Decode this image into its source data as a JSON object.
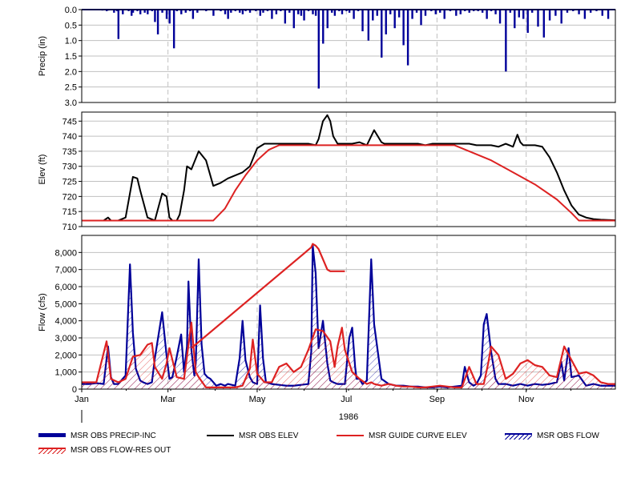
{
  "chart_data": [
    {
      "type": "bar",
      "ylabel": "Precip (in)",
      "ylim": [
        0,
        3
      ],
      "y_inverted": true,
      "yticks": [
        "0.0",
        "0.5",
        "1.0",
        "1.5",
        "2.0",
        "2.5",
        "3.0"
      ],
      "grid": true,
      "series": [
        {
          "name": "MSR OBS PRECIP-INC",
          "color": "#000099",
          "x_day": [
            14,
            17,
            18,
            22,
            24,
            25,
            28,
            32,
            34,
            35,
            38,
            40,
            43,
            45,
            48,
            50,
            52,
            55,
            58,
            60,
            63,
            65,
            68,
            71,
            74,
            76,
            79,
            85,
            90,
            95,
            98,
            100,
            102,
            105,
            108,
            110,
            112,
            115,
            119,
            122,
            124,
            127,
            130,
            133,
            136,
            139,
            142,
            145,
            148,
            150,
            152,
            155,
            158,
            160,
            162,
            165,
            168,
            171,
            173,
            176,
            178,
            181,
            183,
            186,
            189,
            192,
            196,
            199,
            202,
            205,
            208,
            211,
            214,
            217,
            220,
            223,
            226,
            229,
            232,
            235,
            239,
            242,
            245,
            248,
            252,
            256,
            259,
            262,
            265,
            268,
            271,
            274,
            277,
            280,
            283,
            286,
            290,
            293,
            296,
            299,
            302,
            305,
            308,
            312,
            316,
            320,
            324,
            328,
            332,
            336,
            340,
            344,
            348,
            352,
            356,
            360
          ],
          "values": [
            0.03,
            0.05,
            0.03,
            0.1,
            0.05,
            0.95,
            0.15,
            0.05,
            0.2,
            0.1,
            0.05,
            0.15,
            0.1,
            0.15,
            0.05,
            0.4,
            0.8,
            0.1,
            0.3,
            0.45,
            1.25,
            0.05,
            0.15,
            0.1,
            0.05,
            0.3,
            0.1,
            0.05,
            0.2,
            0.05,
            0.15,
            0.3,
            0.1,
            0.05,
            0.1,
            0.15,
            0.05,
            0.1,
            0.05,
            0.2,
            0.1,
            0.05,
            0.3,
            0.15,
            0.05,
            0.45,
            0.1,
            0.6,
            0.15,
            0.2,
            0.35,
            0.05,
            0.15,
            0.2,
            2.55,
            1.1,
            0.6,
            0.1,
            0.2,
            0.05,
            0.15,
            0.05,
            0.1,
            0.3,
            0.05,
            0.7,
            1.0,
            0.35,
            0.2,
            1.55,
            0.8,
            0.15,
            0.6,
            0.25,
            1.15,
            1.8,
            0.3,
            0.1,
            0.5,
            0.2,
            0.05,
            0.15,
            0.1,
            0.3,
            0.05,
            0.2,
            0.15,
            0.05,
            0.1,
            0.05,
            0.05,
            0.1,
            0.3,
            0.05,
            0.15,
            0.45,
            2.0,
            0.1,
            0.6,
            0.25,
            0.3,
            0.75,
            0.1,
            0.55,
            0.9,
            0.35,
            0.2,
            0.45,
            0.1,
            0.05,
            0.15,
            0.3,
            0.1,
            0.05,
            0.2,
            0.3
          ]
        }
      ]
    },
    {
      "type": "line",
      "ylabel": "Elev (ft)",
      "ylim": [
        710,
        748
      ],
      "yticks": [
        "710",
        "715",
        "720",
        "725",
        "730",
        "735",
        "740",
        "745"
      ],
      "grid": true,
      "series": [
        {
          "name": "MSR OBS ELEV",
          "color": "#000000",
          "x_day": [
            0,
            10,
            15,
            18,
            20,
            25,
            30,
            35,
            38,
            40,
            45,
            50,
            55,
            58,
            60,
            62,
            65,
            67,
            70,
            72,
            75,
            80,
            85,
            90,
            95,
            100,
            105,
            110,
            115,
            120,
            125,
            130,
            135,
            140,
            145,
            150,
            155,
            160,
            162,
            165,
            168,
            170,
            172,
            175,
            180,
            185,
            190,
            195,
            200,
            205,
            207,
            210,
            215,
            220,
            225,
            230,
            235,
            240,
            245,
            250,
            255,
            260,
            265,
            270,
            275,
            280,
            285,
            290,
            295,
            298,
            300,
            302,
            305,
            310,
            315,
            320,
            325,
            330,
            335,
            340,
            345,
            350,
            355,
            360,
            365
          ],
          "values": [
            712,
            712,
            712,
            713,
            712,
            712,
            713,
            726.5,
            726,
            722,
            713,
            712,
            721,
            720,
            713,
            712,
            712,
            714,
            722,
            730,
            729,
            735,
            732,
            723.5,
            724.5,
            726,
            727,
            728,
            730,
            736,
            737.5,
            737.5,
            737.5,
            737.5,
            737.5,
            737.5,
            737.5,
            737,
            739,
            745,
            747,
            745,
            740,
            737.5,
            737.5,
            737.5,
            738,
            737,
            742,
            738,
            737.5,
            737.5,
            737.5,
            737.5,
            737.5,
            737.5,
            737,
            737.5,
            737.5,
            737.5,
            737.5,
            737.5,
            737.5,
            737,
            737,
            737,
            736.5,
            737.5,
            736.5,
            740.5,
            738,
            737,
            737,
            737,
            736.5,
            733,
            728,
            722,
            717,
            714,
            713,
            712.5,
            712.3,
            712.2,
            712.1
          ]
        },
        {
          "name": "MSR GUIDE CURVE ELEV",
          "color": "#dd2222",
          "x_day": [
            0,
            90,
            98,
            105,
            112,
            120,
            128,
            135,
            150,
            200,
            255,
            265,
            280,
            295,
            310,
            325,
            335,
            340,
            345,
            365
          ],
          "values": [
            712,
            712,
            716,
            722,
            727,
            732,
            735.5,
            737,
            737,
            737,
            737,
            735,
            732,
            728,
            724,
            719,
            714.5,
            712,
            712,
            712
          ]
        }
      ]
    },
    {
      "type": "line",
      "ylabel": "Flow (cfs)",
      "ylim": [
        0,
        9000
      ],
      "yticks": [
        "0",
        "1,000",
        "2,000",
        "3,000",
        "4,000",
        "5,000",
        "6,000",
        "7,000",
        "8,000"
      ],
      "xticks": [
        "Jan",
        "Mar",
        "May",
        "Jul",
        "Sep",
        "Nov"
      ],
      "xtick_day": [
        0,
        59,
        120,
        181,
        243,
        304
      ],
      "xlabel_year": "1986",
      "grid": true,
      "series": [
        {
          "name": "MSR OBS FLOW",
          "color": "#000099",
          "x_day": [
            0,
            5,
            10,
            15,
            18,
            20,
            22,
            25,
            30,
            33,
            35,
            37,
            40,
            42,
            45,
            48,
            50,
            55,
            58,
            60,
            62,
            65,
            68,
            70,
            72,
            73,
            75,
            77,
            78,
            80,
            82,
            84,
            86,
            88,
            90,
            92,
            95,
            98,
            100,
            105,
            108,
            110,
            112,
            115,
            117,
            120,
            122,
            124,
            126,
            130,
            135,
            140,
            145,
            150,
            155,
            157,
            158,
            160,
            162,
            165,
            168,
            170,
            172,
            175,
            180,
            183,
            185,
            187,
            188,
            190,
            192,
            195,
            198,
            200,
            205,
            210,
            215,
            220,
            225,
            230,
            235,
            240,
            245,
            250,
            255,
            260,
            262,
            265,
            268,
            270,
            273,
            275,
            277,
            280,
            283,
            285,
            290,
            295,
            300,
            305,
            310,
            315,
            320,
            325,
            328,
            330,
            333,
            335,
            340,
            345,
            350,
            355,
            360,
            365
          ],
          "values": [
            300,
            300,
            350,
            300,
            2500,
            700,
            300,
            300,
            800,
            7300,
            3300,
            1200,
            500,
            400,
            300,
            400,
            1800,
            4500,
            2000,
            600,
            700,
            1900,
            3200,
            1000,
            2500,
            6300,
            2300,
            800,
            1500,
            7600,
            2600,
            900,
            700,
            600,
            400,
            200,
            300,
            200,
            300,
            200,
            1800,
            4000,
            1700,
            700,
            400,
            300,
            4900,
            1800,
            400,
            300,
            250,
            200,
            200,
            250,
            300,
            2200,
            8400,
            6800,
            2400,
            4000,
            1500,
            500,
            400,
            300,
            300,
            3000,
            3600,
            1300,
            600,
            600,
            300,
            500,
            7600,
            3800,
            600,
            300,
            200,
            200,
            150,
            150,
            100,
            100,
            150,
            100,
            150,
            200,
            1300,
            400,
            200,
            300,
            800,
            3800,
            4400,
            2200,
            600,
            300,
            300,
            200,
            300,
            200,
            300,
            250,
            300,
            400,
            1600,
            500,
            2400,
            700,
            800,
            200,
            300,
            200,
            200,
            200
          ]
        },
        {
          "name": "MSR OBS FLOW-RES OUT",
          "color": "#dd2222",
          "x_day": [
            0,
            10,
            17,
            20,
            25,
            30,
            35,
            40,
            45,
            48,
            50,
            55,
            58,
            60,
            65,
            70,
            75,
            78,
            80,
            85,
            90,
            95,
            100,
            105,
            110,
            115,
            117,
            120,
            125,
            130,
            135,
            140,
            145,
            150,
            155,
            160,
            165,
            170,
            173,
            175,
            178,
            180,
            185,
            190,
            195,
            198,
            200,
            205,
            210,
            215,
            220,
            225,
            230,
            235,
            240,
            245,
            250,
            255,
            260,
            265,
            270,
            275,
            278,
            280,
            285,
            290,
            295,
            300,
            305,
            310,
            315,
            320,
            325,
            330,
            335,
            340,
            345,
            350,
            355,
            360,
            365
          ],
          "values": [
            400,
            400,
            2800,
            600,
            400,
            600,
            1900,
            2000,
            2600,
            2700,
            1300,
            600,
            1500,
            2400,
            700,
            600,
            3900,
            1000,
            700,
            100,
            100,
            100,
            100,
            100,
            200,
            1200,
            2900,
            900,
            400,
            400,
            1300,
            1500,
            1000,
            1300,
            2300,
            3500,
            3400,
            2800,
            1300,
            2500,
            3600,
            2300,
            1000,
            600,
            300,
            400,
            300,
            200,
            300,
            200,
            150,
            150,
            100,
            100,
            150,
            200,
            150,
            100,
            100,
            1300,
            300,
            300,
            1500,
            2500,
            2000,
            600,
            900,
            1500,
            1700,
            1400,
            1300,
            800,
            700,
            2500,
            1700,
            900,
            1000,
            800,
            400,
            300,
            300
          ]
        },
        {
          "name": "MSR OBS FLOW-RES OUT (gap)",
          "color": "#dd2222",
          "x_day": [
            75,
            157,
            158,
            160,
            162,
            165,
            168,
            170,
            175,
            180
          ],
          "values": [
            2400,
            8300,
            8500,
            8400,
            8200,
            7600,
            7000,
            6900,
            6900,
            6900
          ]
        }
      ]
    }
  ],
  "legend": [
    {
      "label": "MSR OBS PRECIP-INC",
      "swatch": "thick-blue"
    },
    {
      "label": "MSR OBS ELEV",
      "swatch": "black-line"
    },
    {
      "label": "MSR GUIDE CURVE ELEV",
      "swatch": "red-line"
    },
    {
      "label": "MSR OBS FLOW",
      "swatch": "blue-hatch"
    },
    {
      "label": "MSR OBS FLOW-RES OUT",
      "swatch": "red-hatch"
    }
  ],
  "colors": {
    "precip": "#000099",
    "elev": "#000000",
    "guide": "#dd2222",
    "flow": "#000099",
    "resout": "#dd2222",
    "grid": "#c0c0c0"
  }
}
